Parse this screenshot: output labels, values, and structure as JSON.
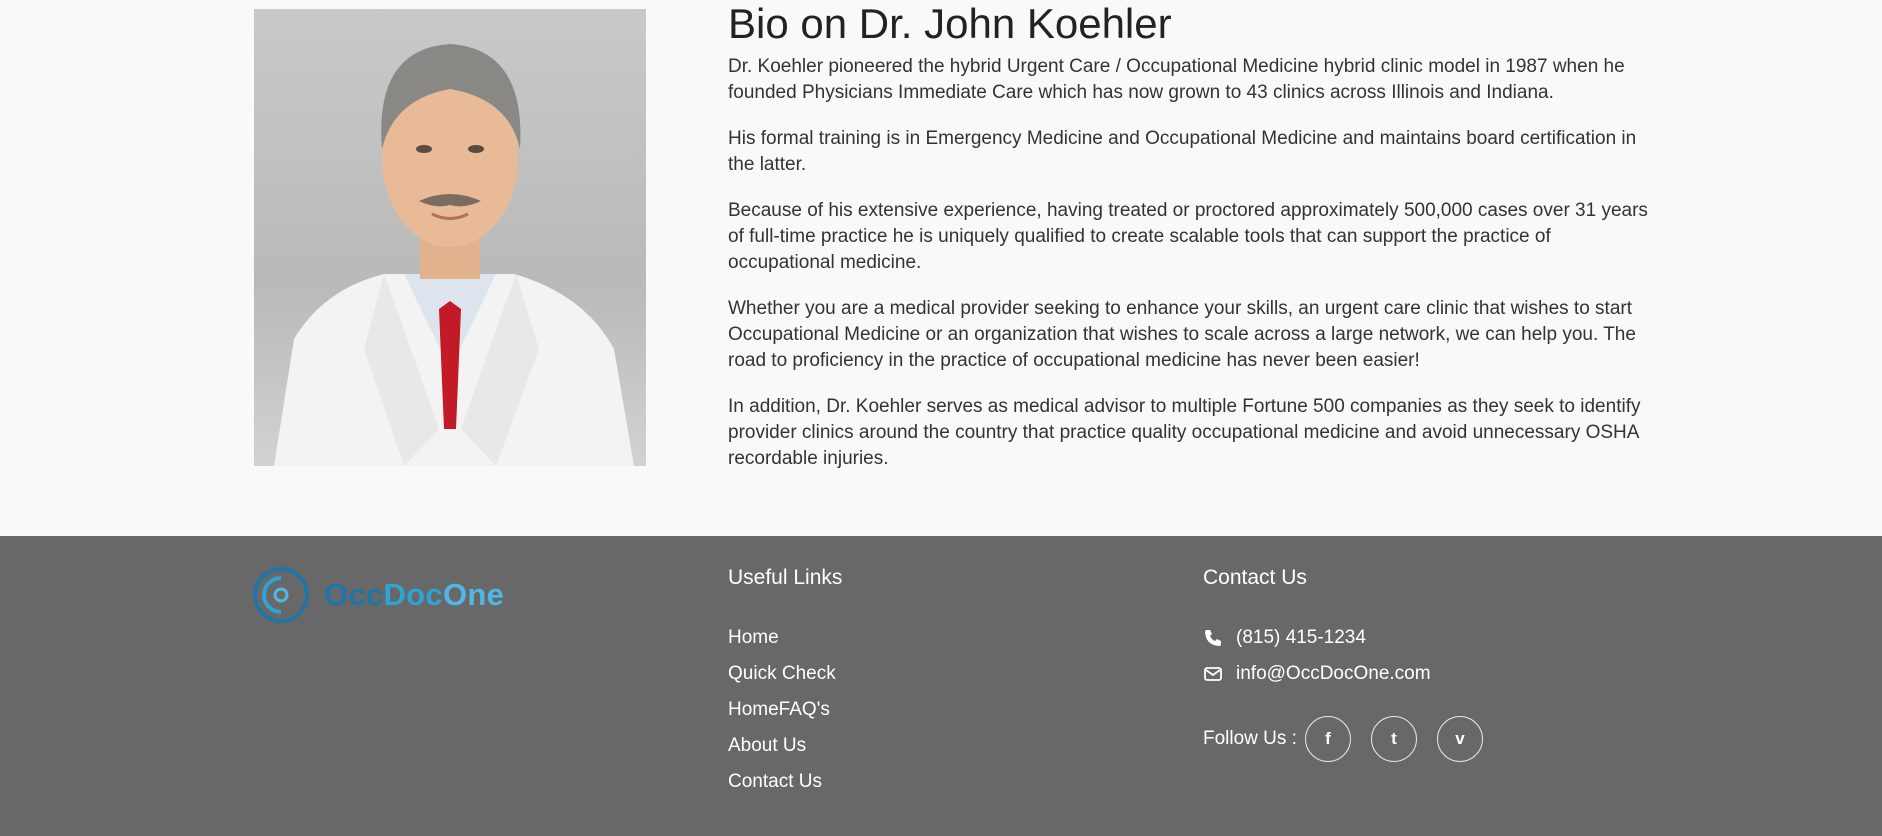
{
  "bio": {
    "title": "Bio on Dr. John Koehler",
    "paragraphs": [
      "Dr. Koehler pioneered the hybrid Urgent Care / Occupational Medicine hybrid clinic model in 1987 when he founded Physicians Immediate Care which has now grown to 43 clinics across Illinois and Indiana.",
      "His formal training is in Emergency Medicine and Occupational Medicine and maintains board certification in the latter.",
      "Because of his extensive experience, having treated or proctored approximately  500,000 cases over 31 years of full-time practice he is uniquely qualified to create scalable tools that can support the practice of occupational medicine.",
      "Whether you are a medical provider seeking to enhance your skills, an urgent care clinic that wishes to start Occupational Medicine or an organization that wishes to scale across a large network, we can help you.  The road to proficiency in the practice of occupational medicine has never been easier!",
      "In addition, Dr. Koehler serves as medical advisor to multiple Fortune 500 companies as they seek to identify provider clinics around the country that practice quality occupational medicine and avoid unnecessary OSHA recordable injuries."
    ]
  },
  "footer": {
    "logo": {
      "part1": "Occ",
      "part2": "Doc",
      "part3": "One"
    },
    "useful_links": {
      "heading": "Useful Links",
      "items": [
        "Home",
        "Quick Check",
        "HomeFAQ's",
        "About Us",
        "Contact Us"
      ]
    },
    "contact": {
      "heading": "Contact Us",
      "phone": "(815) 415-1234",
      "email": "info@OccDocOne.com",
      "follow_label": "Follow Us :",
      "social": [
        {
          "icon": "facebook-icon",
          "glyph": "f"
        },
        {
          "icon": "twitter-icon",
          "glyph": "t"
        },
        {
          "icon": "vimeo-icon",
          "glyph": "v"
        }
      ]
    }
  },
  "colors": {
    "footer_bg": "#686868",
    "logo_dark": "#1f74a8",
    "logo_mid": "#2ea3d6",
    "logo_light": "#4fb8e6"
  }
}
